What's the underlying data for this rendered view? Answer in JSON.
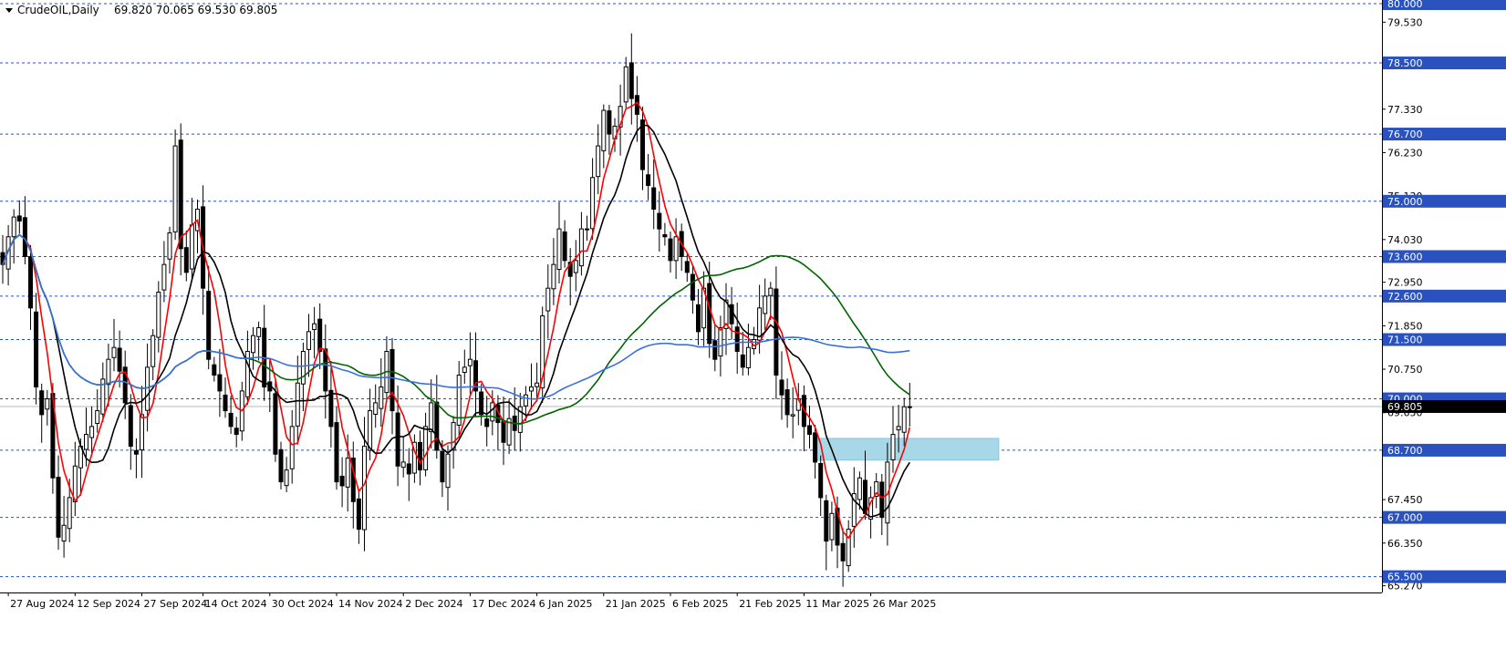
{
  "header": {
    "symbol": "CrudeOIL,Daily",
    "ohlc": "69.820 70.065 69.530 69.805"
  },
  "colors": {
    "background": "#ffffff",
    "grid_dashed": "#2a52be",
    "candle": "#000000",
    "ma_red": "#ff0000",
    "ma_black": "#000000",
    "ma_green": "#006400",
    "ma_blue": "#3a6fe0",
    "zone": "#a8d8e8",
    "price_tag_bg": "#2a52be",
    "current_tag_bg": "#000000"
  },
  "chart_data": {
    "type": "candlestick",
    "timeframe": "Daily",
    "y_range": [
      65.1,
      80.0
    ],
    "y_tick_labels": [
      "79.530",
      "77.330",
      "76.230",
      "75.130",
      "74.030",
      "72.950",
      "71.850",
      "70.750",
      "69.650",
      "67.450",
      "66.350",
      "65.270"
    ],
    "horizontal_levels": [
      80.0,
      78.5,
      76.7,
      75.0,
      73.6,
      72.6,
      71.5,
      70.0,
      68.7,
      67.0,
      65.5
    ],
    "horizontal_level_labels": [
      "80.000",
      "78.500",
      "76.700",
      "75.000",
      "73.600",
      "72.600",
      "71.500",
      "70.000",
      "68.700",
      "67.000",
      "65.500"
    ],
    "current_price": 69.805,
    "current_price_label": "69.805",
    "x_tick_labels": [
      "27 Aug 2024",
      "12 Sep 2024",
      "27 Sep 2024",
      "14 Oct 2024",
      "30 Oct 2024",
      "14 Nov 2024",
      "2 Dec 2024",
      "17 Dec 2024",
      "6 Jan 2025",
      "21 Jan 2025",
      "6 Feb 2025",
      "21 Feb 2025",
      "11 Mar 2025",
      "26 Mar 2025"
    ],
    "x_tick_bar_index": [
      1,
      13,
      25,
      36,
      48,
      60,
      72,
      84,
      96,
      108,
      120,
      132,
      144,
      156
    ],
    "zone": {
      "bar_from": 146,
      "bar_to": 179,
      "low": 68.45,
      "high": 69.0
    },
    "closes": [
      73.4,
      74.1,
      74.6,
      74.5,
      73.6,
      72.3,
      70.3,
      69.6,
      70.0,
      68.0,
      66.5,
      66.8,
      67.5,
      68.3,
      68.8,
      69.1,
      69.3,
      69.7,
      70.5,
      71.0,
      71.3,
      70.7,
      69.9,
      68.8,
      68.6,
      69.6,
      70.8,
      71.6,
      72.7,
      73.4,
      74.2,
      76.4,
      73.8,
      73.2,
      74.4,
      74.8,
      72.8,
      71.0,
      70.6,
      70.2,
      69.7,
      69.3,
      69.1,
      70.2,
      71.2,
      71.6,
      71.8,
      70.3,
      70.2,
      68.6,
      67.9,
      68.2,
      69.3,
      70.4,
      71.2,
      71.7,
      71.9,
      71.2,
      70.2,
      69.3,
      67.9,
      67.8,
      68.5,
      67.4,
      66.7,
      68.8,
      69.7,
      69.9,
      70.3,
      71.2,
      69.7,
      68.3,
      68.4,
      68.1,
      68.9,
      68.2,
      69.3,
      69.9,
      68.7,
      67.9,
      68.6,
      69.4,
      70.6,
      70.8,
      71.0,
      70.2,
      69.6,
      69.3,
      69.9,
      69.4,
      68.9,
      69.5,
      69.2,
      69.8,
      70.1,
      70.3,
      70.4,
      72.1,
      72.8,
      73.4,
      74.3,
      73.5,
      73.1,
      73.5,
      74.3,
      74.3,
      75.6,
      76.4,
      77.3,
      76.7,
      76.9,
      77.4,
      78.4,
      77.6,
      77.2,
      75.8,
      75.4,
      74.8,
      74.3,
      74.1,
      73.5,
      74.1,
      73.6,
      73.2,
      72.5,
      71.7,
      72.8,
      71.4,
      71.0,
      71.8,
      72.5,
      71.9,
      71.2,
      70.8,
      71.3,
      71.5,
      72.3,
      72.6,
      72.8,
      70.6,
      70.1,
      69.6,
      69.6,
      70.0,
      69.3,
      69.1,
      68.4,
      67.5,
      66.4,
      67.1,
      66.3,
      65.9,
      66.7,
      67.6,
      68.0,
      67.1,
      67.5,
      67.9,
      67.0,
      68.4,
      69.1,
      69.3,
      69.8,
      69.8
    ]
  }
}
